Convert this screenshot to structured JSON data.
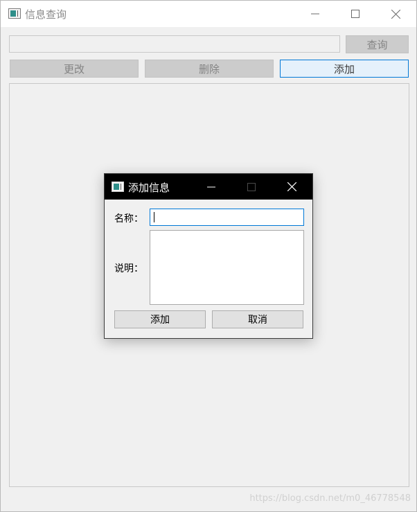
{
  "main_window": {
    "title": "信息查询",
    "search_placeholder": "",
    "query_button": "查询",
    "edit_button": "更改",
    "delete_button": "删除",
    "add_button": "添加",
    "controls": [
      "minimize-icon",
      "maximize-icon",
      "close-icon"
    ]
  },
  "dialog": {
    "title": "添加信息",
    "name_label": "名称：",
    "description_label": "说明：",
    "name_value": "",
    "description_value": "",
    "confirm_button": "添加",
    "cancel_button": "取消",
    "controls": [
      "minimize-icon",
      "maximize-icon",
      "close-icon"
    ]
  },
  "watermark": "https://blog.csdn.net/m0_46778548",
  "colors": {
    "accent": "#0078d7",
    "window_bg": "#f0f0f0",
    "disabled_button": "#cccccc",
    "dialog_titlebar": "#000000",
    "icon_teal": "#2f8f8a"
  }
}
